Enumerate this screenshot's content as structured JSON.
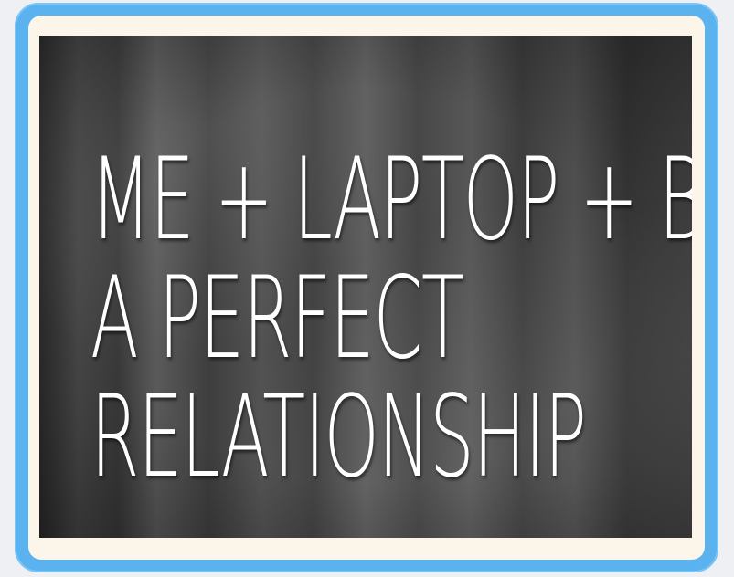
{
  "quote": {
    "line1": "ME + LAPTOP + BED =",
    "line2": "A PERFECT",
    "line3": "RELATIONSHIP"
  }
}
